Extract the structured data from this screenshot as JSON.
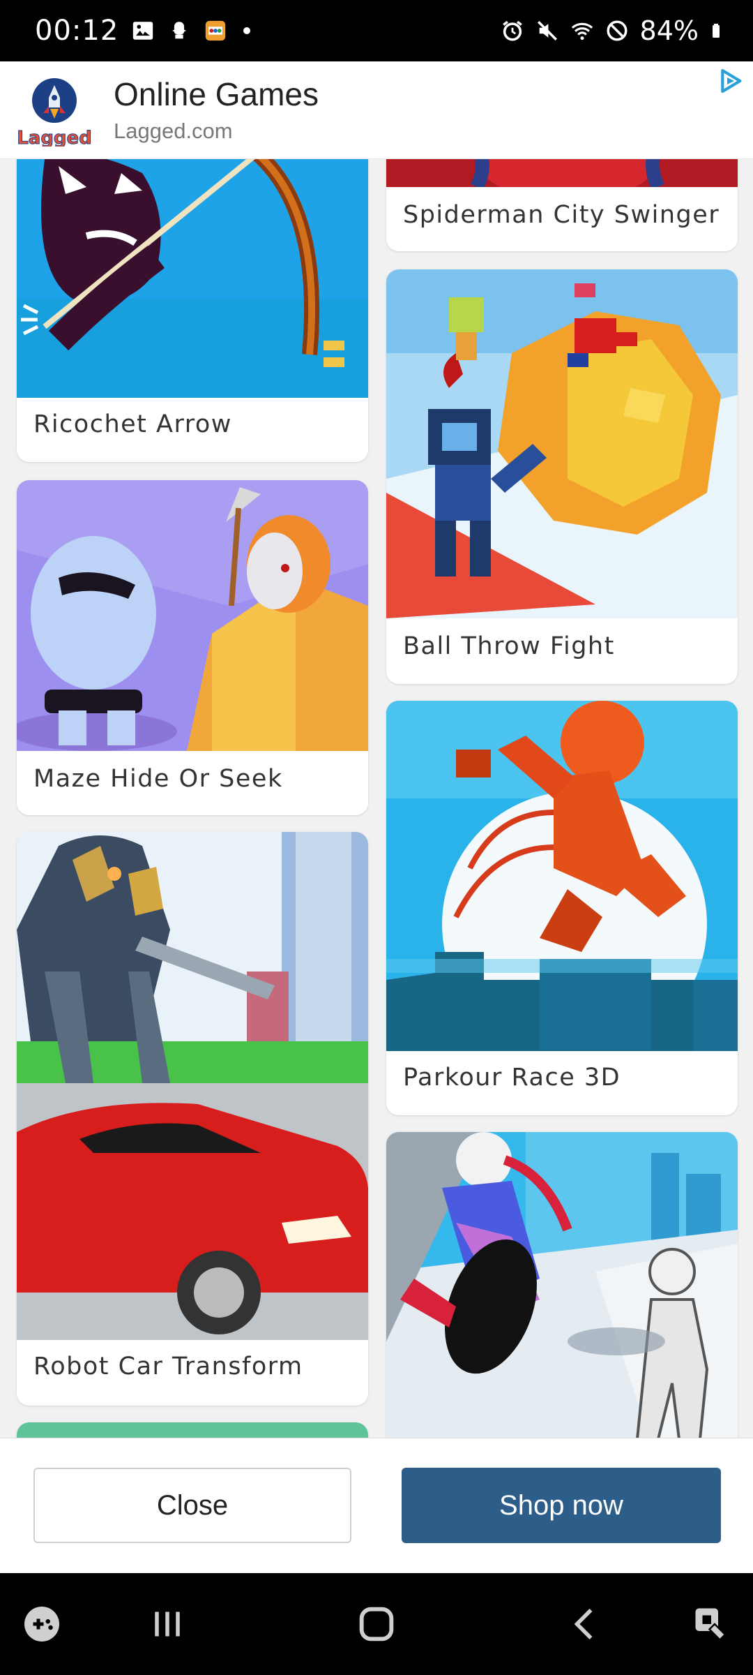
{
  "status_bar": {
    "time": "00:12",
    "battery": "84%",
    "icons_left": [
      "gallery-icon",
      "snapchat-icon",
      "game-app-icon",
      "dot-icon"
    ],
    "icons_right": [
      "alarm-icon",
      "mute-icon",
      "wifi-icon",
      "do-not-disturb-icon",
      "battery-icon"
    ]
  },
  "ad": {
    "logo_text": "Lagged",
    "title": "Online Games",
    "domain": "Lagged.com",
    "choices_icon": "ad-choices-icon"
  },
  "games": {
    "left": [
      {
        "title": "Ricochet Arrow",
        "thumb_color": "#1fa3e8"
      },
      {
        "title": "Maze Hide Or Seek",
        "thumb_color": "#9c8ff0"
      },
      {
        "title": "Robot Car Transform",
        "thumb_color": "#6fc5ea"
      }
    ],
    "right": [
      {
        "title": "Spiderman City Swinger",
        "thumb_color": "#c0262d"
      },
      {
        "title": "Ball Throw Fight",
        "thumb_color": "#7cc2ee"
      },
      {
        "title": "Parkour Race 3D",
        "thumb_color": "#2ab3ea"
      },
      {
        "title": "",
        "thumb_color": "#35b8ec"
      }
    ]
  },
  "cta": {
    "close_label": "Close",
    "shop_label": "Shop now"
  },
  "nav": {
    "icons": [
      "game-launcher-icon",
      "recent-apps-icon",
      "home-icon",
      "back-icon",
      "accessibility-icon"
    ]
  },
  "colors": {
    "shop_button": "#2d5e8a",
    "background": "#f1f1f1"
  }
}
